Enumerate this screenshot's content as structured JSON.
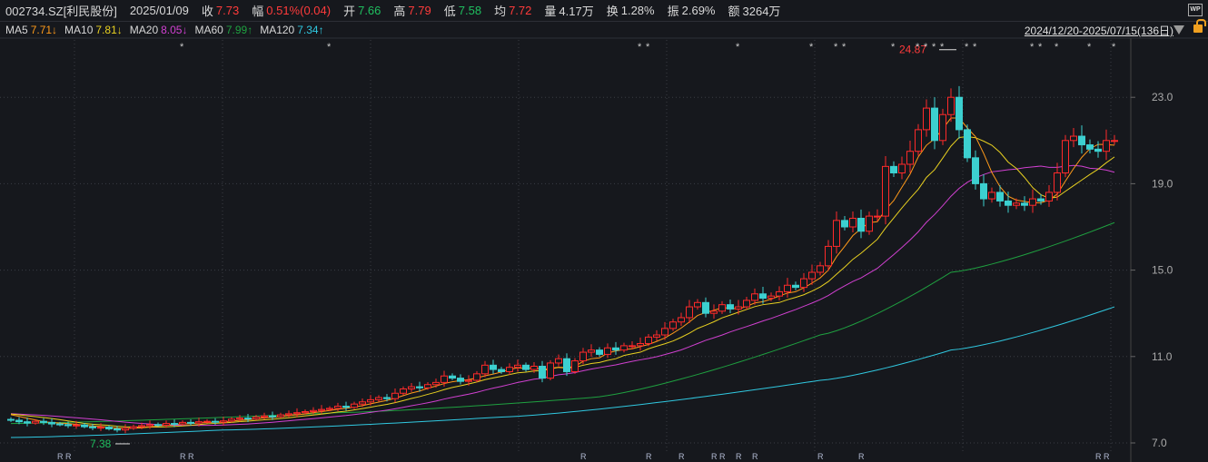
{
  "header": {
    "code": "002734.SZ[利民股份]",
    "date": "2025/01/09",
    "close_label": "收",
    "close": "7.73",
    "chg_label": "幅",
    "chg": "0.51%(0.04)",
    "open_label": "开",
    "open": "7.66",
    "high_label": "高",
    "high": "7.79",
    "low_label": "低",
    "low": "7.58",
    "avg_label": "均",
    "avg": "7.72",
    "vol_label": "量",
    "vol": "4.17万",
    "turn_label": "换",
    "turn": "1.28%",
    "amp_label": "振",
    "amp": "2.69%",
    "amt_label": "额",
    "amt": "3264万"
  },
  "ma": [
    {
      "name": "MA5",
      "value": "7.71↓",
      "color": "#ff9a1a"
    },
    {
      "name": "MA10",
      "value": "7.81↓",
      "color": "#e8d020"
    },
    {
      "name": "MA20",
      "value": "8.05↓",
      "color": "#d040d0"
    },
    {
      "name": "MA60",
      "value": "7.99↑",
      "color": "#1fa040"
    },
    {
      "name": "MA120",
      "value": "7.34↑",
      "color": "#30c8e0"
    }
  ],
  "range": "2024/12/20-2025/07/15(136日)",
  "wp_badge": "WP",
  "chart_data": {
    "type": "candlestick",
    "y_ticks": [
      "23.0",
      "19.0",
      "15.0",
      "11.0",
      "7.0"
    ],
    "ylim": [
      7.0,
      25.0
    ],
    "close": [
      8.05,
      7.98,
      7.92,
      8.0,
      7.95,
      7.88,
      7.85,
      7.8,
      7.83,
      7.75,
      7.7,
      7.73,
      7.65,
      7.6,
      7.68,
      7.75,
      7.8,
      7.85,
      7.82,
      7.9,
      7.88,
      7.95,
      7.92,
      7.98,
      8.0,
      7.96,
      8.02,
      8.1,
      8.15,
      8.12,
      8.2,
      8.25,
      8.22,
      8.3,
      8.35,
      8.4,
      8.45,
      8.5,
      8.55,
      8.6,
      8.7,
      8.65,
      8.8,
      8.9,
      9.0,
      9.1,
      9.05,
      9.3,
      9.5,
      9.6,
      9.55,
      9.7,
      9.8,
      10.1,
      10.0,
      9.85,
      9.9,
      10.2,
      10.6,
      10.4,
      10.3,
      10.5,
      10.6,
      10.4,
      10.55,
      10.0,
      10.7,
      10.9,
      10.3,
      10.8,
      11.2,
      11.3,
      11.1,
      11.4,
      11.3,
      11.5,
      11.5,
      11.6,
      11.9,
      12.0,
      12.3,
      12.6,
      12.8,
      13.3,
      13.5,
      13.0,
      13.1,
      13.4,
      13.2,
      13.3,
      13.6,
      13.9,
      13.7,
      13.8,
      14.0,
      14.3,
      14.2,
      14.6,
      14.9,
      15.2,
      16.1,
      17.3,
      17.0,
      17.4,
      16.8,
      17.5,
      17.5,
      19.8,
      19.5,
      19.9,
      20.5,
      21.5,
      22.5,
      21.0,
      22.2,
      23.0,
      21.5,
      20.2,
      19.0,
      18.3,
      18.6,
      18.2,
      18.0,
      18.1,
      18.0,
      18.3,
      18.2,
      18.6,
      19.5,
      21.0,
      21.2,
      20.8,
      20.6,
      20.5,
      21.0,
      21.0
    ],
    "ma60_samples": [
      [
        0,
        7.9
      ],
      [
        40,
        8.4
      ],
      [
        71,
        9.1
      ],
      [
        99,
        12.0
      ],
      [
        115,
        14.9
      ],
      [
        135,
        17.2
      ]
    ],
    "ma120_samples": [
      [
        0,
        7.25
      ],
      [
        26,
        7.6
      ],
      [
        60,
        8.2
      ],
      [
        99,
        9.9
      ],
      [
        115,
        11.3
      ],
      [
        135,
        13.3
      ]
    ],
    "high_marker": {
      "index": 114,
      "label": "24.87",
      "value": 24.87
    },
    "low_marker": {
      "index": 13,
      "label": "7.38",
      "value": 7.38
    },
    "star_indices": [
      21,
      39,
      77,
      78,
      89,
      98,
      101,
      102,
      108,
      111,
      112,
      113,
      114,
      117,
      118,
      125,
      126,
      128,
      132,
      135
    ],
    "r_indices": [
      6,
      7,
      21,
      22,
      70,
      78,
      82,
      86,
      87,
      89,
      91,
      99,
      104,
      133,
      134
    ],
    "star_glyph": "*",
    "r_glyph": "R",
    "colors": {
      "up": "#ff2a2a",
      "down": "#3cd0d0"
    }
  }
}
